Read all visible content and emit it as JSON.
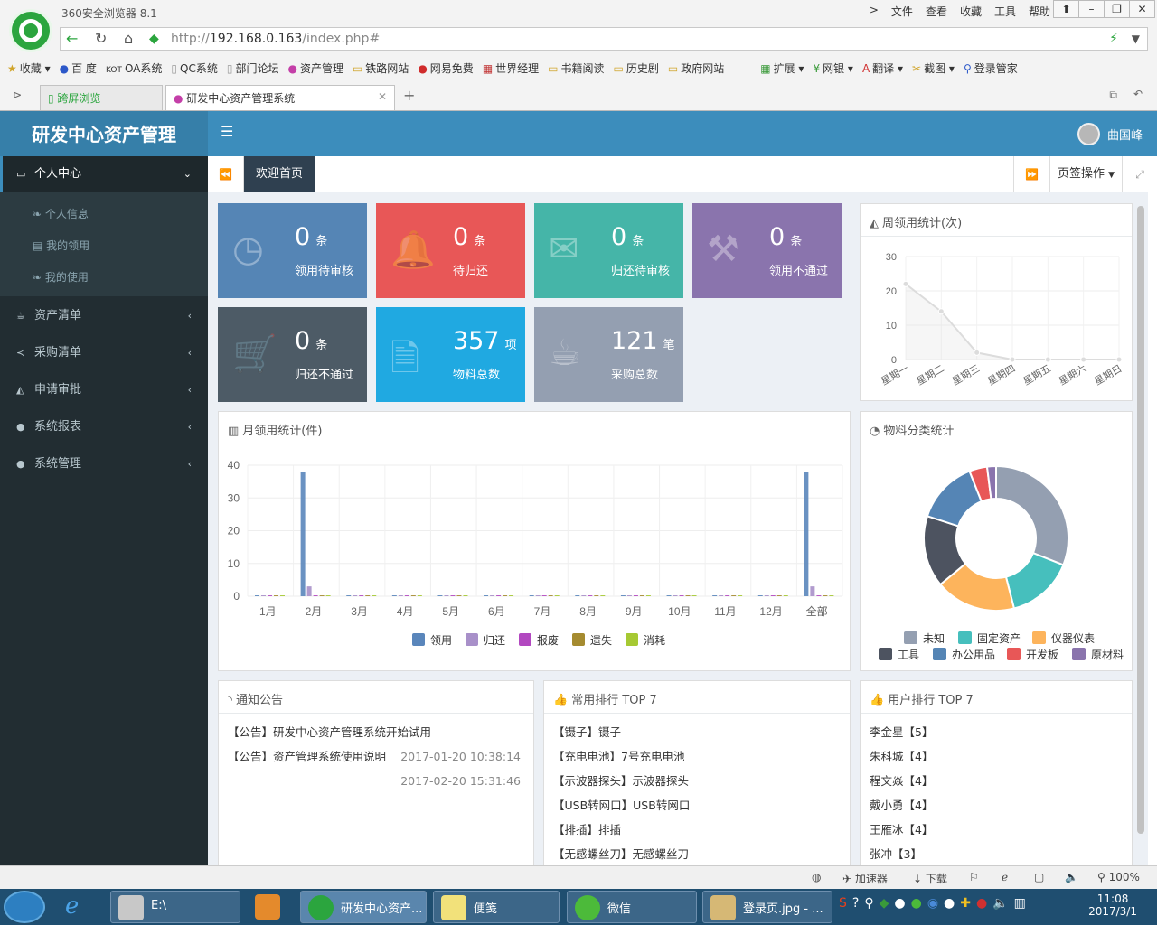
{
  "browser": {
    "title": "360安全浏览器 8.1",
    "menu": [
      "文件",
      "查看",
      "收藏",
      "工具",
      "帮助"
    ],
    "url_prefix": "http://",
    "url_host": "192.168.0.163",
    "url_path": "/index.php#",
    "favorites": [
      "收藏",
      "百 度",
      "OA系统",
      "QC系统",
      "部门论坛",
      "资产管理",
      "铁路网站",
      "网易免费",
      "世界经理",
      "书籍阅读",
      "历史剧",
      "政府网站"
    ],
    "tools": [
      "扩展",
      "网银",
      "翻译",
      "截图",
      "登录管家"
    ],
    "tab1": "跨屏浏览",
    "tab2": "研发中心资产管理系统",
    "status_items": [
      "加速器",
      "下载",
      "100%"
    ]
  },
  "app": {
    "brand": "研发中心资产管理",
    "user": "曲国峰",
    "sidebar": {
      "personal": "个人中心",
      "sub": [
        "个人信息",
        "我的领用",
        "我的使用"
      ],
      "items": [
        "资产清单",
        "采购清单",
        "申请审批",
        "系统报表",
        "系统管理"
      ]
    },
    "tabs": {
      "home": "欢迎首页",
      "ops": "页签操作"
    }
  },
  "stats": [
    {
      "num": "0",
      "unit": "条",
      "label": "领用待审核",
      "color": "#5585b5"
    },
    {
      "num": "0",
      "unit": "条",
      "label": "待归还",
      "color": "#e85757"
    },
    {
      "num": "0",
      "unit": "条",
      "label": "归还待审核",
      "color": "#45b5a8"
    },
    {
      "num": "0",
      "unit": "条",
      "label": "领用不通过",
      "color": "#8a74ad"
    },
    {
      "num": "0",
      "unit": "条",
      "label": "归还不通过",
      "color": "#4d5b66"
    },
    {
      "num": "357",
      "unit": "项",
      "label": "物料总数",
      "color": "#20a9e1"
    },
    {
      "num": "121",
      "unit": "笔",
      "label": "采购总数",
      "color": "#949fb1"
    }
  ],
  "panels": {
    "weekly": "周领用统计(次)",
    "monthly": "月领用统计(件)",
    "category": "物料分类统计",
    "notice": "通知公告",
    "top": "常用排行 TOP 7",
    "usertop": "用户排行 TOP 7"
  },
  "chart_data": [
    {
      "type": "line",
      "title": "周领用统计(次)",
      "categories": [
        "星期一",
        "星期二",
        "星期三",
        "星期四",
        "星期五",
        "星期六",
        "星期日"
      ],
      "values": [
        22,
        14,
        2,
        0,
        0,
        0,
        0
      ],
      "ylim": [
        0,
        30
      ],
      "yticks": [
        0,
        10,
        20,
        30
      ],
      "color": "#dcdcdc"
    },
    {
      "type": "bar",
      "title": "月领用统计(件)",
      "categories": [
        "1月",
        "2月",
        "3月",
        "4月",
        "5月",
        "6月",
        "7月",
        "8月",
        "9月",
        "10月",
        "11月",
        "12月",
        "全部"
      ],
      "ylim": [
        0,
        40
      ],
      "yticks": [
        0,
        10,
        20,
        30,
        40
      ],
      "series": [
        {
          "name": "领用",
          "color": "#5a86bb",
          "values": [
            0,
            38,
            0,
            0,
            0,
            0,
            0,
            0,
            0,
            0,
            0,
            0,
            38
          ]
        },
        {
          "name": "归还",
          "color": "#a890c9",
          "values": [
            0,
            3,
            0,
            0,
            0,
            0,
            0,
            0,
            0,
            0,
            0,
            0,
            3
          ]
        },
        {
          "name": "报废",
          "color": "#b248c0",
          "values": [
            0,
            0,
            0,
            0,
            0,
            0,
            0,
            0,
            0,
            0,
            0,
            0,
            0
          ]
        },
        {
          "name": "遗失",
          "color": "#a58b30",
          "values": [
            0,
            0,
            0,
            0,
            0,
            0,
            0,
            0,
            0,
            0,
            0,
            0,
            0
          ]
        },
        {
          "name": "消耗",
          "color": "#a6c933",
          "values": [
            0,
            0,
            0,
            0,
            0,
            0,
            0,
            0,
            0,
            0,
            0,
            0,
            0
          ]
        }
      ],
      "legend": "bottom"
    },
    {
      "type": "pie",
      "title": "物料分类统计",
      "categories": [
        "未知",
        "固定资产",
        "仪器仪表",
        "工具",
        "办公用品",
        "开发板",
        "原材料"
      ],
      "values": [
        31,
        15,
        18,
        16,
        14,
        4,
        2
      ],
      "colors": [
        "#949fb1",
        "#46bfbd",
        "#fdb45c",
        "#4d5360",
        "#5585b5",
        "#e85757",
        "#8a74ad"
      ],
      "legend": "bottom"
    }
  ],
  "notices": [
    {
      "text": "【公告】研发中心资产管理系统开始试用",
      "time": ""
    },
    {
      "text": "【公告】资产管理系统使用说明",
      "time": "2017-01-20 10:38:14"
    },
    {
      "text": "",
      "time": "2017-02-20 15:31:46"
    }
  ],
  "top7": [
    "【镊子】镊子",
    "【充电电池】7号充电电池",
    "【示波器探头】示波器探头",
    "【USB转网口】USB转网口",
    "【排插】排插",
    "【无感螺丝刀】无感螺丝刀"
  ],
  "usertop": [
    "李金星【5】",
    "朱科城【4】",
    "程文焱【4】",
    "戴小勇【4】",
    "王雁冰【4】",
    "张冲【3】"
  ],
  "taskbar": {
    "items": [
      "E:\\",
      "研发中心资产...",
      "便笺",
      "微信",
      "登录页.jpg - ..."
    ],
    "time": "11:08",
    "date": "2017/3/1"
  }
}
